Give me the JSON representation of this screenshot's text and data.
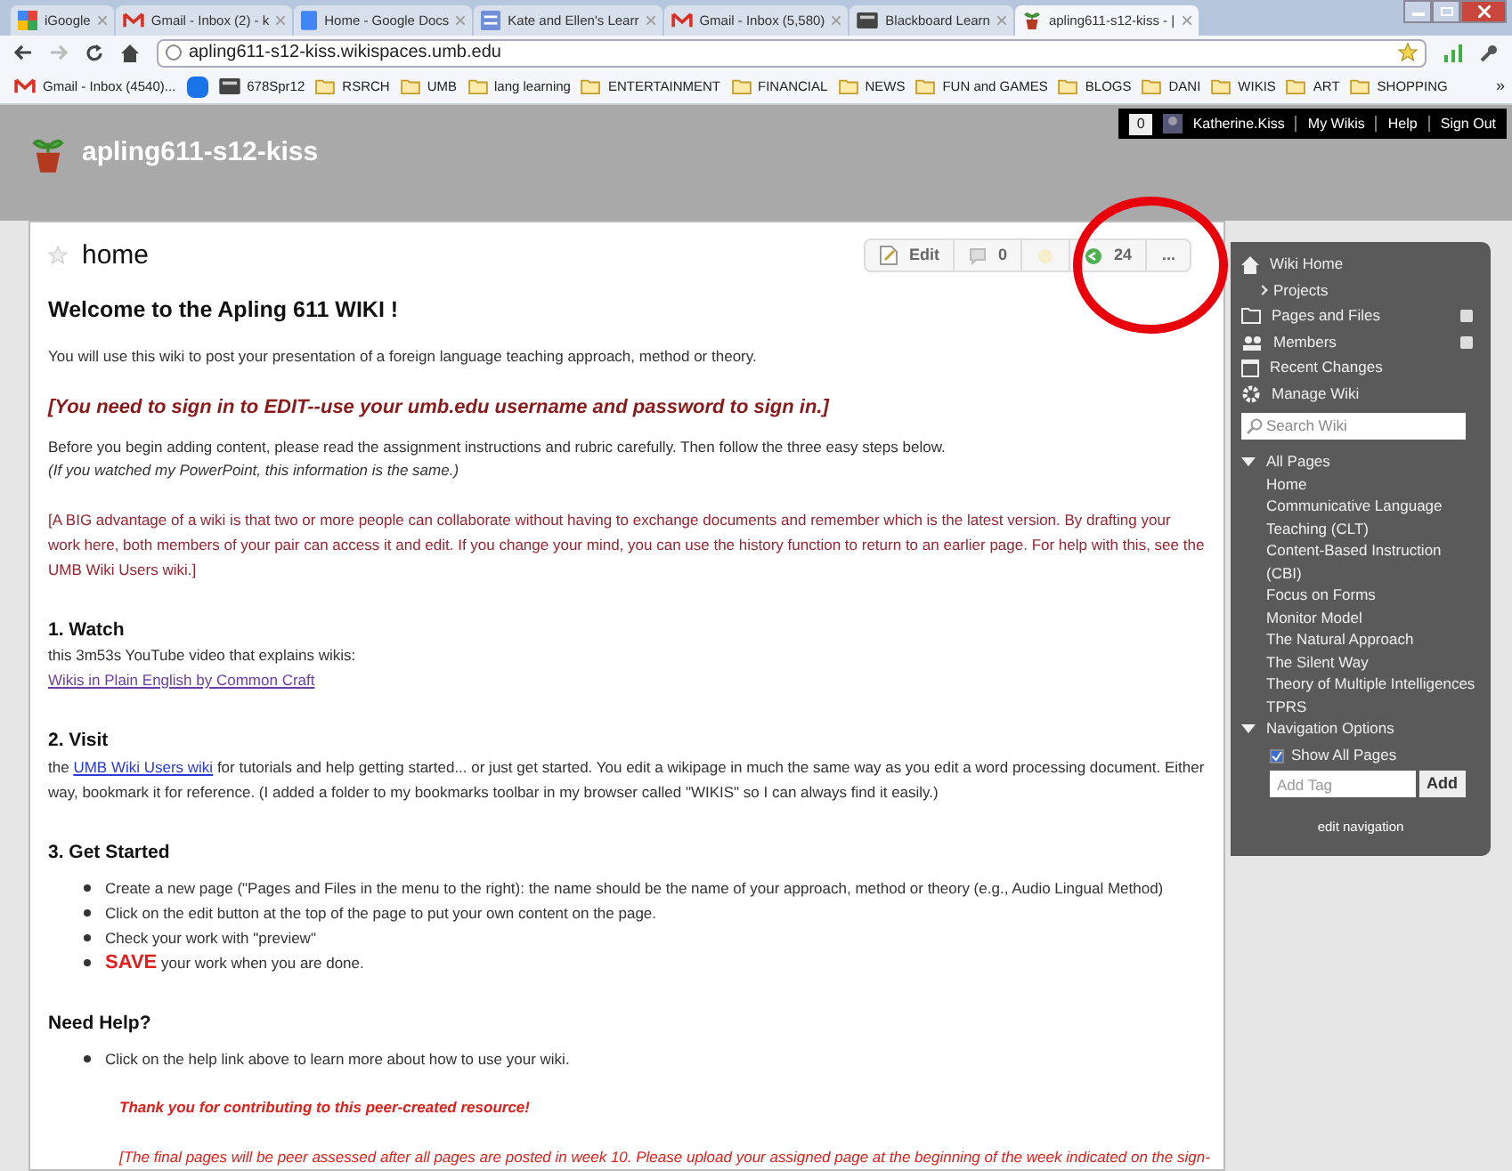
{
  "browser": {
    "tabs": [
      {
        "title": "iGoogle",
        "kind": "google",
        "selected": false
      },
      {
        "title": "Gmail - Inbox (2) - k",
        "kind": "gmail",
        "selected": false
      },
      {
        "title": "Home - Google Docs",
        "kind": "docs",
        "selected": false
      },
      {
        "title": "Kate and Ellen's Learr",
        "kind": "form",
        "selected": false
      },
      {
        "title": "Gmail - Inbox (5,580)",
        "kind": "gmail",
        "selected": false
      },
      {
        "title": "Blackboard Learn",
        "kind": "board",
        "selected": false
      },
      {
        "title": "apling611-s12-kiss - |",
        "kind": "plant",
        "selected": true
      }
    ],
    "url": "apling611-s12-kiss.wikispaces.umb.edu",
    "bookmarks": [
      {
        "label": "Gmail - Inbox (4540)...",
        "kind": "gmail"
      },
      {
        "kind": "d"
      },
      {
        "label": "678Spr12",
        "kind": "board"
      },
      {
        "label": "RSRCH",
        "kind": "folder"
      },
      {
        "label": "UMB",
        "kind": "folder"
      },
      {
        "label": "lang learning",
        "kind": "folder"
      },
      {
        "label": "ENTERTAINMENT",
        "kind": "folder"
      },
      {
        "label": "FINANCIAL",
        "kind": "folder"
      },
      {
        "label": "NEWS",
        "kind": "folder"
      },
      {
        "label": "FUN and GAMES",
        "kind": "folder"
      },
      {
        "label": "BLOGS",
        "kind": "folder"
      },
      {
        "label": "DANI",
        "kind": "folder"
      },
      {
        "label": "WIKIS",
        "kind": "folder"
      },
      {
        "label": "ART",
        "kind": "folder"
      },
      {
        "label": "SHOPPING",
        "kind": "folder"
      }
    ],
    "more": "»"
  },
  "account_bar": {
    "count": "0",
    "user": "Katherine.Kiss",
    "links": [
      "My Wikis",
      "Help",
      "Sign Out"
    ]
  },
  "site_title": "apling611-s12-kiss",
  "page": {
    "title": "home",
    "toolbar": [
      {
        "kind": "edit",
        "label": "Edit"
      },
      {
        "kind": "comments",
        "label": "0"
      },
      {
        "kind": "follow"
      },
      {
        "kind": "history",
        "label": "24"
      },
      {
        "kind": "more",
        "label": "..."
      }
    ],
    "blocks": [
      {
        "kind": "title",
        "parts": [
          {
            "text": "Welcome to the Apling 611 WIKI !"
          }
        ]
      },
      {
        "kind": "para",
        "parts": [
          {
            "text": "You will use this wiki to post your presentation of a foreign language teaching approach, method or theory."
          }
        ]
      },
      {
        "kind": "alert",
        "parts": [
          {
            "text": "[You need to sign in to EDIT--use your umb.edu username and password to sign in.]"
          }
        ]
      },
      {
        "kind": "para",
        "parts": [
          {
            "text": "Before you begin adding content, please read the assignment instructions and rubric carefully. Then follow the three easy steps below."
          }
        ]
      },
      {
        "kind": "aside",
        "parts": [
          {
            "text": "(If you watched my PowerPoint, this information is the same.)"
          }
        ]
      },
      {
        "kind": "notice",
        "parts": [
          {
            "text": "[A BIG advantage of a wiki is that two or more people can collaborate without having to exchange documents and remember which is the latest version. By drafting your work here, both members of your pair can access it and edit. If you change your mind, you can use the history function to return to an earlier page. For help with this, see the UMB Wiki Users wiki.]"
          }
        ]
      },
      {
        "kind": "section",
        "parts": [
          {
            "text": "1. Watch"
          }
        ]
      },
      {
        "kind": "line",
        "parts": [
          {
            "text": "this 3m53s YouTube video that explains wikis:"
          }
        ]
      },
      {
        "kind": "line",
        "parts": [
          {
            "text": "Wikis in Plain English by Common Craft",
            "link": true,
            "visited": true
          }
        ]
      },
      {
        "kind": "section",
        "parts": [
          {
            "text": "2. Visit"
          }
        ]
      },
      {
        "kind": "line",
        "parts": [
          {
            "text": "the "
          },
          {
            "text": "UMB Wiki Users wiki",
            "link": true,
            "visited": false
          },
          {
            "text": " for tutorials and help getting started... or just get started. You edit a wikipage in much the same way as you edit a word processing document. Either way, bookmark it for reference. (I added a folder to my bookmarks toolbar in my browser called \"WIKIS\" so I can always find it easily.)"
          }
        ]
      },
      {
        "kind": "section",
        "parts": [
          {
            "text": "3. Get Started"
          }
        ]
      },
      {
        "kind": "bullets",
        "items": [
          [
            {
              "text": "Create a new page (\"Pages and Files in the menu to the right): the name should be the name of your approach, method or theory (e.g., Audio Lingual Method)"
            }
          ],
          [
            {
              "text": "Click on the edit button at the top of the page to put your own content on the page."
            }
          ],
          [
            {
              "text": "Check your work with \"preview\""
            }
          ],
          [
            {
              "text": "SAVE",
              "strong": true
            },
            {
              "text": " your work when you are done."
            }
          ]
        ]
      },
      {
        "kind": "section",
        "parts": [
          {
            "text": "Need Help?"
          }
        ]
      },
      {
        "kind": "bullets",
        "items": [
          [
            {
              "text": "Click on the help link above to learn more about how to use your wiki."
            }
          ]
        ]
      },
      {
        "kind": "thanks",
        "parts": [
          {
            "text": "Thank you for contributing to this peer-created resource!"
          }
        ]
      },
      {
        "kind": "final",
        "parts": [
          {
            "text": "[The final pages will be peer assessed after all pages are posted in week 10. Please upload your assigned page at the beginning of the week indicated on the sign-"
          }
        ]
      }
    ]
  },
  "sidebar": {
    "nav": [
      {
        "label": "Wiki Home",
        "kind": "home",
        "children": [
          {
            "label": "Projects"
          }
        ]
      },
      {
        "label": "Pages and Files",
        "kind": "folder",
        "add": true
      },
      {
        "label": "Members",
        "kind": "members",
        "add": true
      },
      {
        "label": "Recent Changes",
        "kind": "calendar"
      },
      {
        "label": "Manage Wiki",
        "kind": "gear"
      }
    ],
    "search": {
      "placeholder": "Search Wiki"
    },
    "sections": [
      {
        "label": "All Pages",
        "expanded": true,
        "pages": [
          "Home",
          "Communicative Language Teaching (CLT)",
          "Content-Based Instruction (CBI)",
          "Focus on Forms",
          "Monitor Model",
          "The Natural Approach",
          "The Silent Way",
          "Theory of Multiple Intelligences",
          "TPRS"
        ]
      },
      {
        "label": "Navigation Options",
        "expanded": true,
        "option": {
          "label": "Show All Pages",
          "checked": true
        },
        "tag": {
          "placeholder": "Add Tag",
          "button": "Add"
        }
      }
    ],
    "footer": "edit navigation"
  }
}
